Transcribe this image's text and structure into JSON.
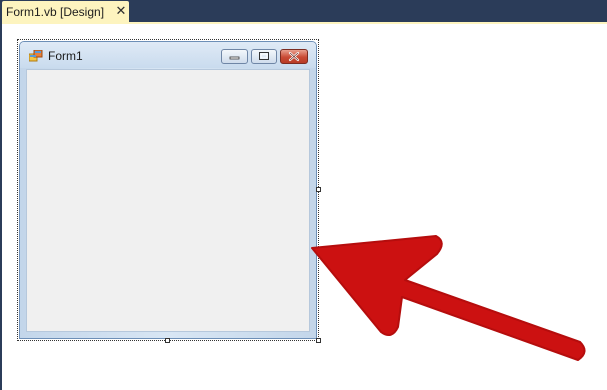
{
  "document_tab": {
    "label": "Form1.vb [Design]",
    "close_glyph": "✕"
  },
  "form": {
    "title": "Form1",
    "icon": "form-app-icon",
    "caption_buttons": [
      "minimize-icon",
      "maximize-icon",
      "close-icon"
    ],
    "client_background": "#f0f0f0"
  },
  "annotation": {
    "icon": "red-arrow",
    "color": "#cc1111"
  },
  "colors": {
    "ide_chrome": "#2b3c59",
    "active_tab": "#fdf4bf",
    "window_frame": "#c3d6ea"
  }
}
